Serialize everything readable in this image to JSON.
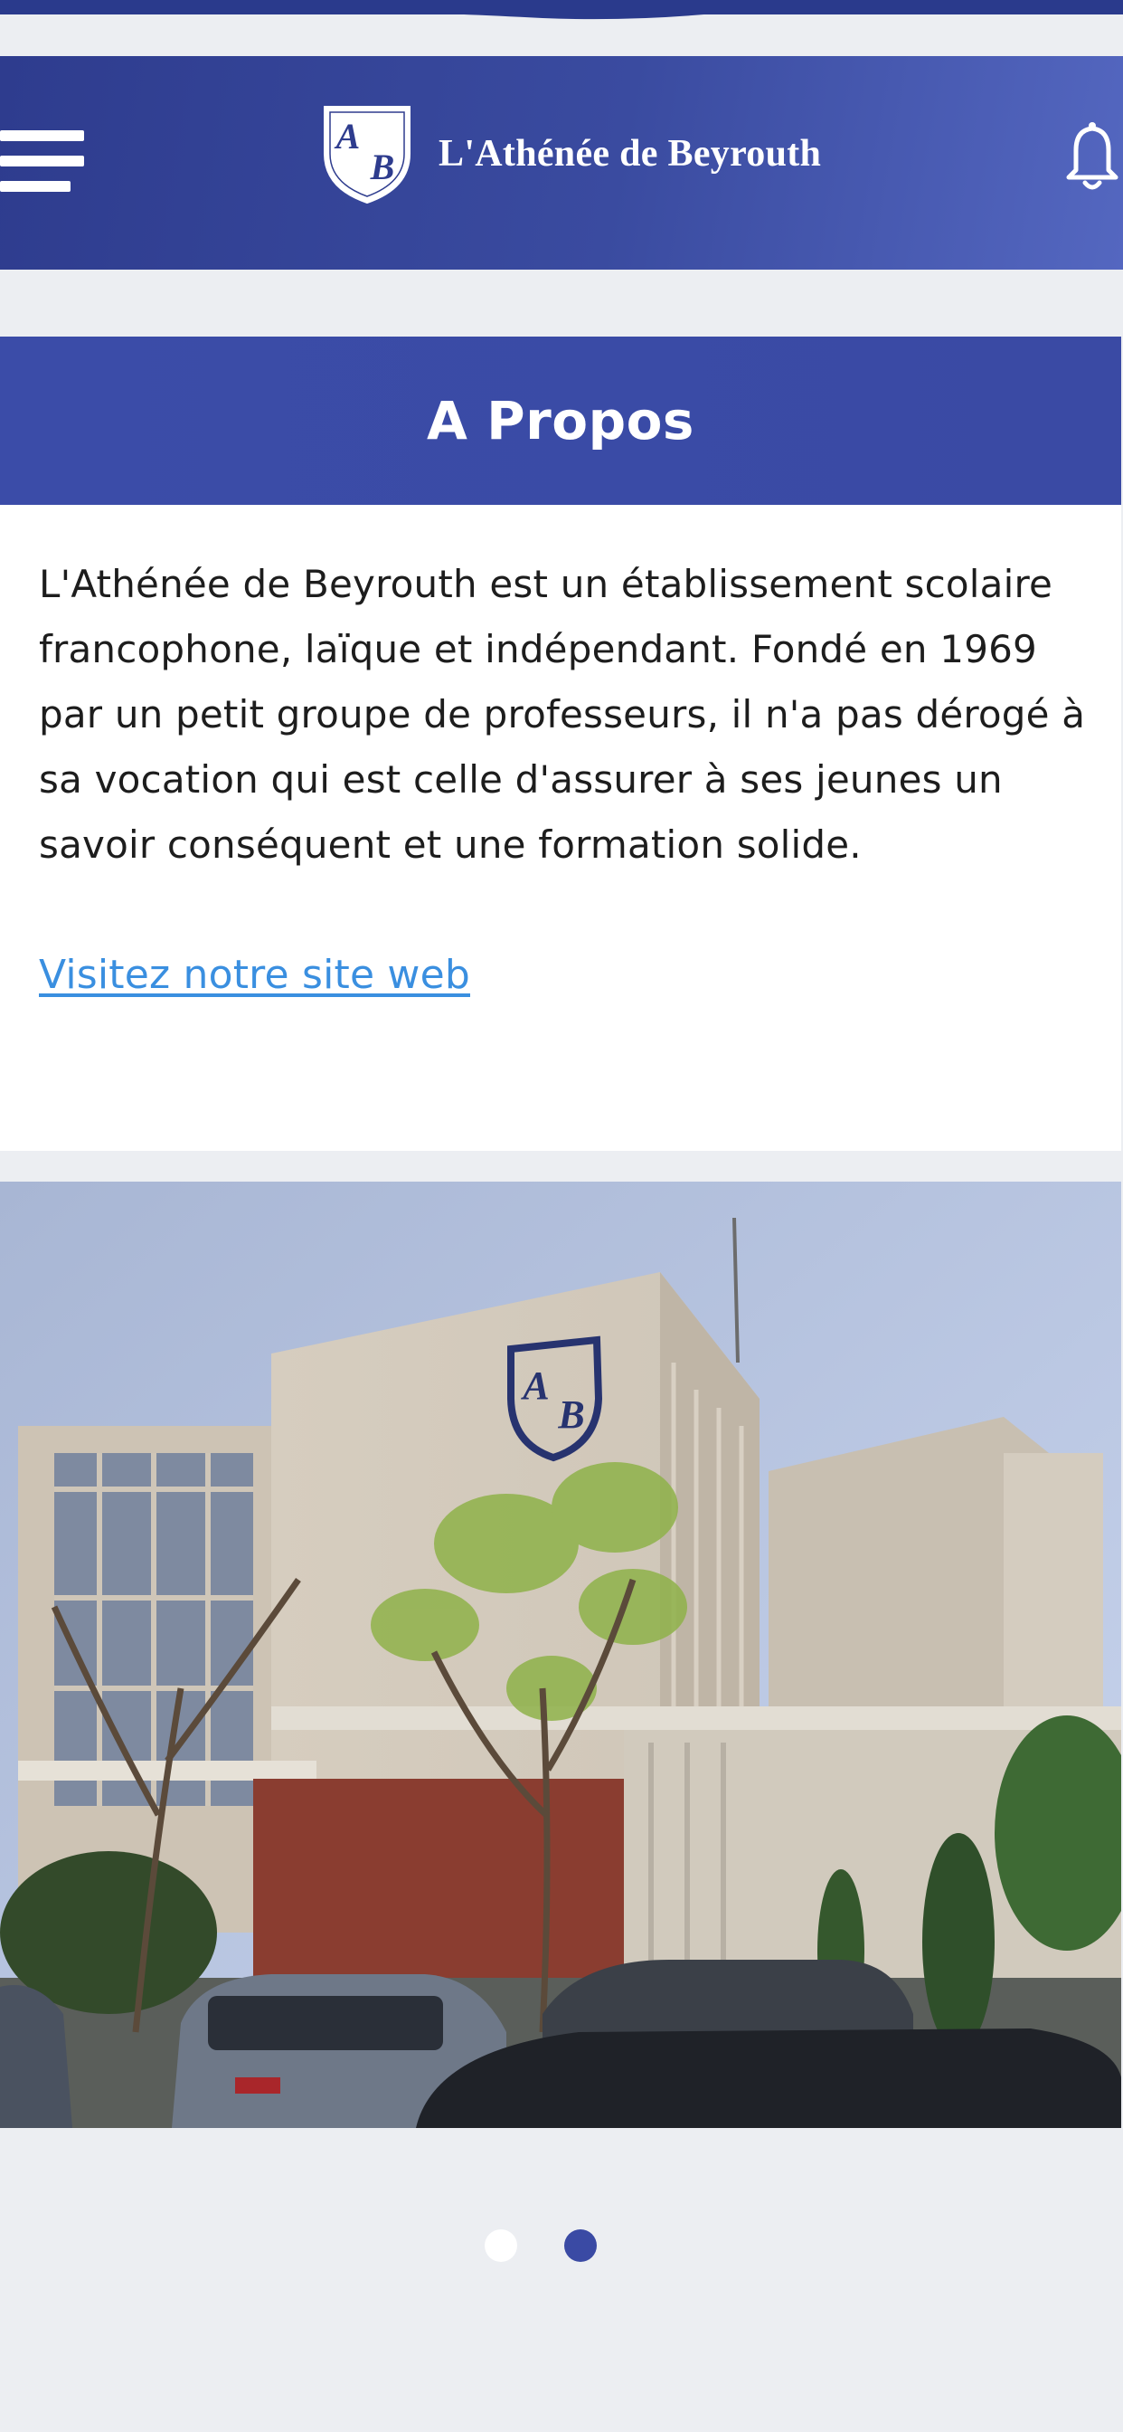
{
  "app": {
    "brand_name": "L'Athénée de Beyrouth",
    "crest_letters": [
      "A",
      "B"
    ]
  },
  "header": {
    "menu_icon": "hamburger-menu-icon",
    "notification_icon": "bell-icon"
  },
  "about": {
    "title": "A Propos",
    "text": "L'Athénée de Beyrouth est un établissement scolaire francophone, laïque et indépendant. Fondé en 1969 par un petit groupe de professeurs, il n'a pas dérogé à sa vocation qui est celle d'assurer à ses jeunes un savoir conséquent et une formation solide.",
    "link_label": "Visitez notre site web"
  },
  "carousel": {
    "active_index": 2,
    "total": 2
  },
  "colors": {
    "brand_blue": "#3a4aa4",
    "link_blue": "#3a8fe0",
    "background": "#eceef2"
  }
}
